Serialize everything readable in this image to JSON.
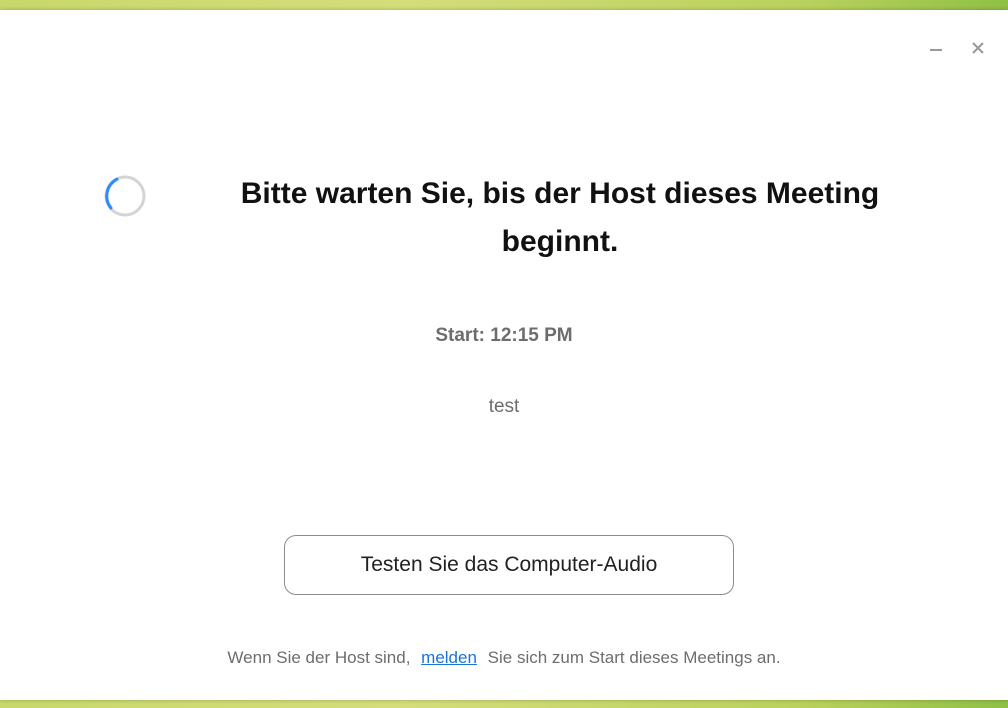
{
  "window": {
    "minimize_icon": "minimize-icon",
    "close_icon": "close-icon"
  },
  "waiting": {
    "spinner_icon": "loading-spinner-icon",
    "title_line1": "Bitte warten Sie, bis der Host dieses Meeting",
    "title_line2": "beginnt.",
    "start_time": "Start: 12:15 PM",
    "meeting_name": "test"
  },
  "actions": {
    "test_audio_label": "Testen Sie das Computer-Audio"
  },
  "footer": {
    "prefix": "Wenn Sie der Host sind,",
    "link_label": "melden",
    "suffix": "Sie sich zum Start dieses Meetings an."
  },
  "colors": {
    "accent_link": "#1a73d9",
    "spinner_active": "#2d8cff",
    "spinner_track": "#d4d4d4",
    "secondary_text": "#6d6d6d"
  }
}
